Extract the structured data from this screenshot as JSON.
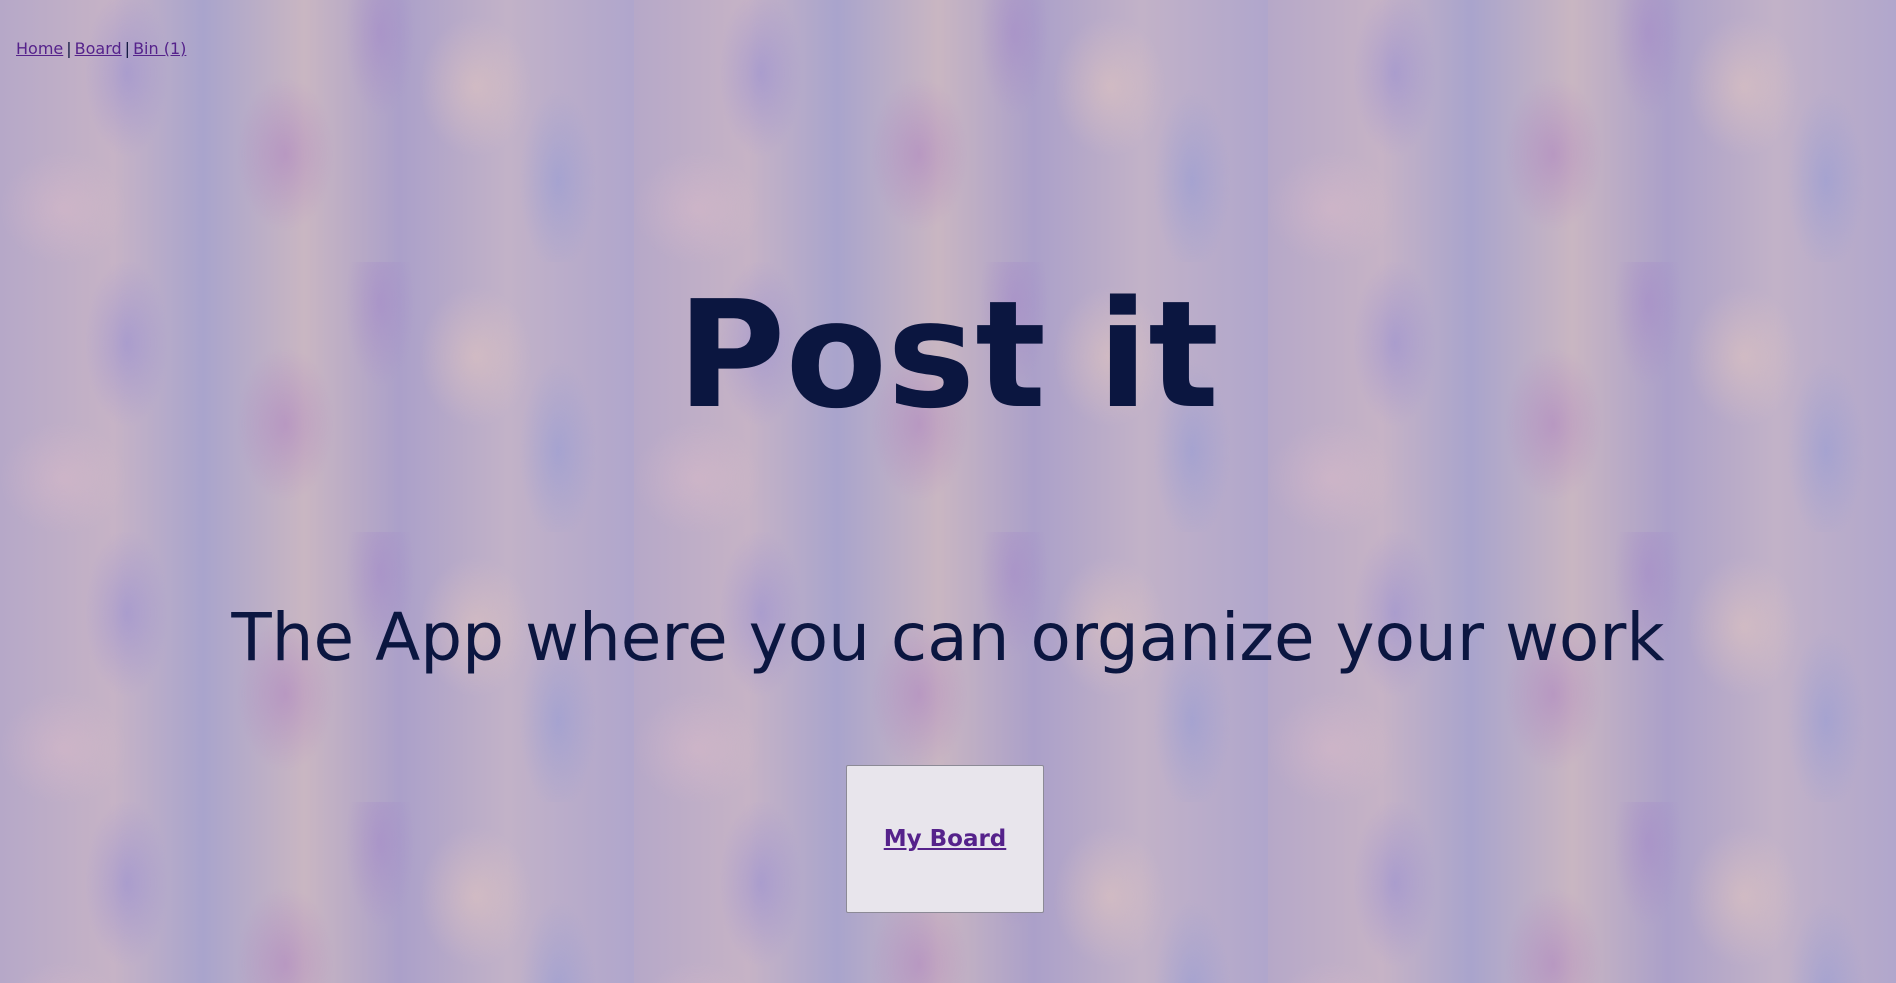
{
  "nav": {
    "home": "Home",
    "separator": "|",
    "board": "Board",
    "bin": "Bin (1)"
  },
  "hero": {
    "title": "Post it",
    "subtitle": "The App where you can organize your work"
  },
  "cta": {
    "label": "My Board"
  },
  "colors": {
    "text": "#0b1640",
    "link": "#55228b",
    "card": "#e8e5ec"
  }
}
